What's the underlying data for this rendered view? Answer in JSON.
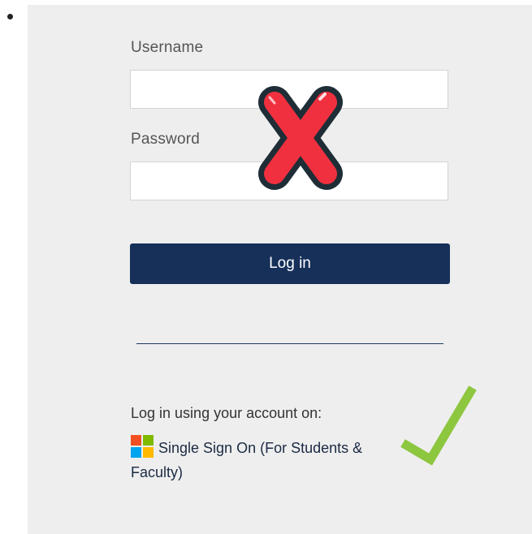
{
  "form": {
    "username_label": "Username",
    "username_value": "",
    "password_label": "Password",
    "password_value": "",
    "login_button": "Log in"
  },
  "sso": {
    "caption": "Log in using your account on:",
    "link_label": "Single Sign On (For Students & Faculty)",
    "icon": "microsoft-logo-icon"
  },
  "overlays": {
    "cross_icon": "red-x-icon",
    "check_icon": "green-check-icon"
  },
  "colors": {
    "panel_bg": "#eeeeee",
    "button_bg": "#16305a",
    "cross": "#f0303f",
    "check": "#8dc63f"
  }
}
